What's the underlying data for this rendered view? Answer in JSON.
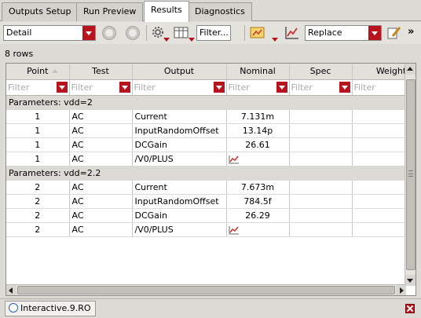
{
  "tabs": [
    {
      "label": "Outputs Setup",
      "active": false
    },
    {
      "label": "Run Preview",
      "active": false
    },
    {
      "label": "Results",
      "active": true
    },
    {
      "label": "Diagnostics",
      "active": false
    }
  ],
  "toolbar": {
    "view_select": "Detail",
    "filter_select": "Filter...",
    "mode_select": "Replace",
    "overflow_label": "»"
  },
  "row_count": "8 rows",
  "table": {
    "columns": [
      "Point",
      "Test",
      "Output",
      "Nominal",
      "Spec",
      "Weight"
    ],
    "filter_placeholder": "Filter",
    "groups": [
      {
        "label": "Parameters: vdd=2",
        "rows": [
          {
            "point": "1",
            "test": "AC",
            "output": "Current",
            "nominal": "7.131m"
          },
          {
            "point": "1",
            "test": "AC",
            "output": "InputRandomOffset",
            "nominal": "13.14p"
          },
          {
            "point": "1",
            "test": "AC",
            "output": "DCGain",
            "nominal": "26.61"
          },
          {
            "point": "1",
            "test": "AC",
            "output": "/V0/PLUS",
            "nominal": ""
          }
        ]
      },
      {
        "label": "Parameters: vdd=2.2",
        "rows": [
          {
            "point": "2",
            "test": "AC",
            "output": "Current",
            "nominal": "7.673m"
          },
          {
            "point": "2",
            "test": "AC",
            "output": "InputRandomOffset",
            "nominal": "784.5f"
          },
          {
            "point": "2",
            "test": "AC",
            "output": "DCGain",
            "nominal": "26.29"
          },
          {
            "point": "2",
            "test": "AC",
            "output": "/V0/PLUS",
            "nominal": ""
          }
        ]
      }
    ]
  },
  "status": {
    "tab_label": "Interactive.9.RO"
  },
  "colors": {
    "accent_red": "#b8141e",
    "plot_icon": "#d03030"
  }
}
